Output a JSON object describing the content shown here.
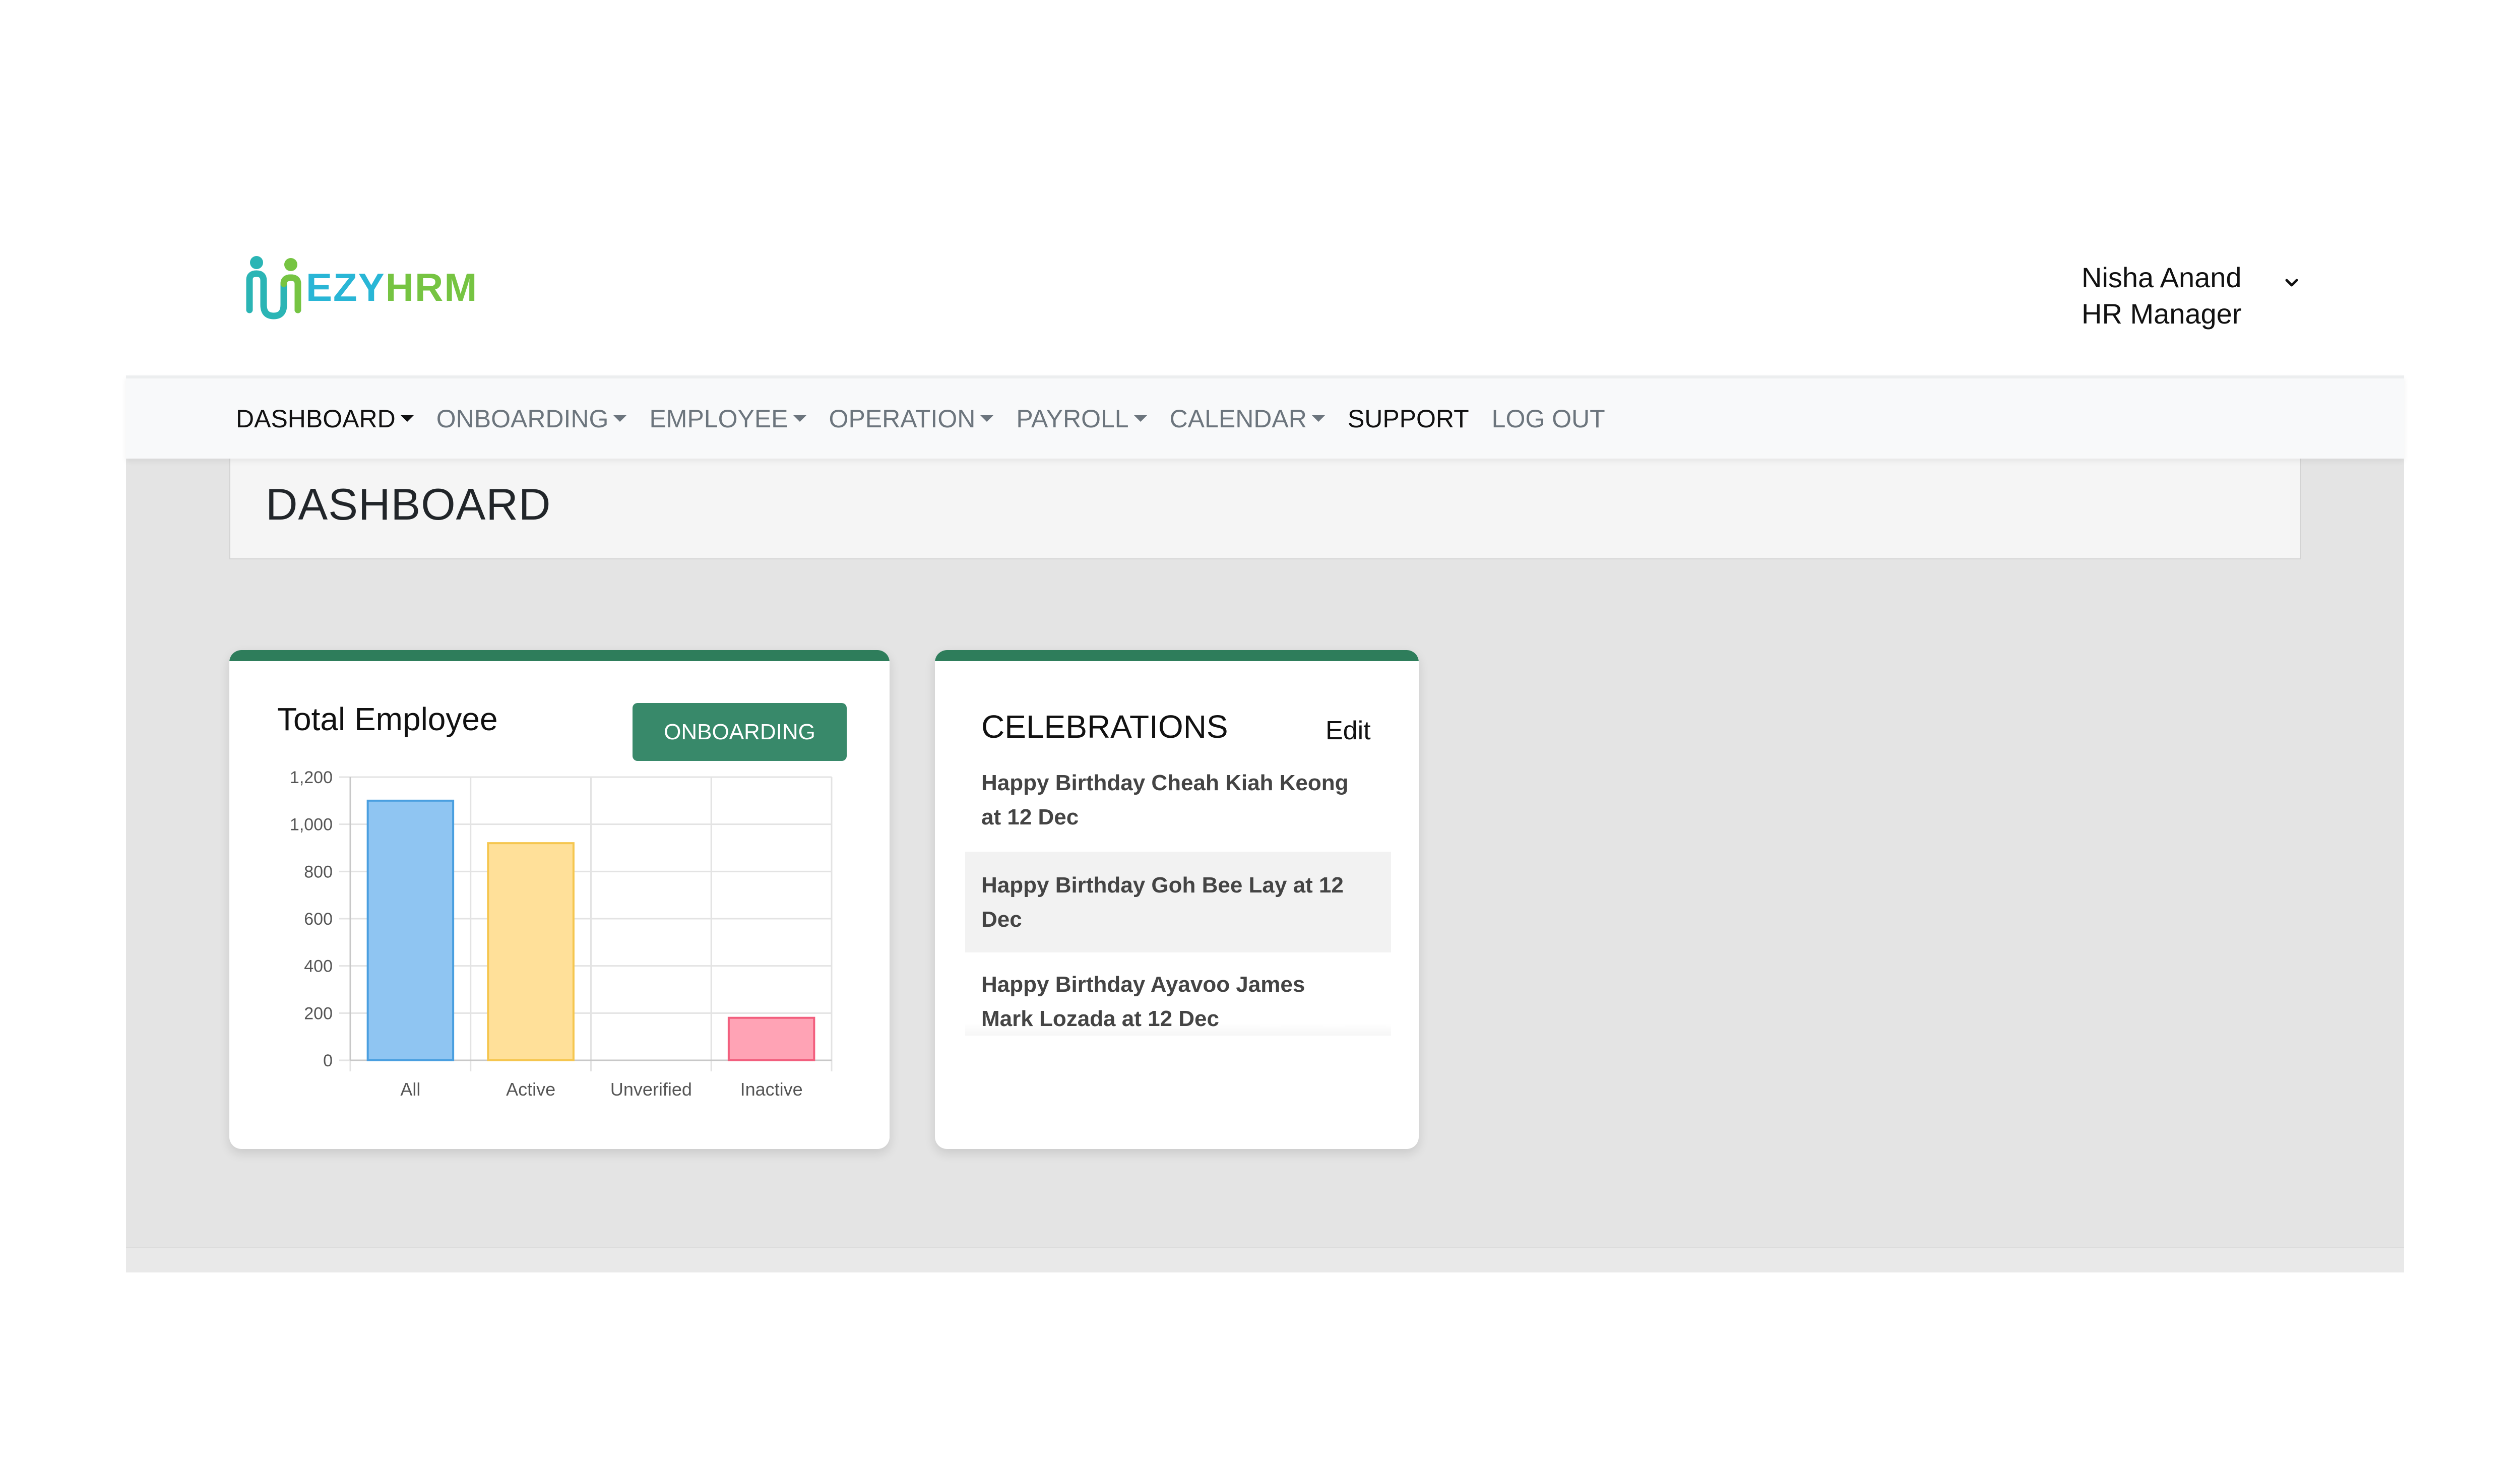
{
  "brand": {
    "ezy": "EZY",
    "hrm": "HRM",
    "colors": {
      "ezy": "#29b6d6",
      "hrm": "#76c442"
    }
  },
  "user": {
    "name": "Nisha Anand",
    "role": "HR Manager",
    "icon": "chevron-down-icon"
  },
  "nav": {
    "dashboard": "DASHBOARD",
    "onboarding": "ONBOARDING",
    "employee": "EMPLOYEE",
    "operation": "OPERATION",
    "payroll": "PAYROLL",
    "calendar": "CALENDAR",
    "support": "SUPPORT",
    "logout": "LOG OUT"
  },
  "page": {
    "title": "DASHBOARD"
  },
  "total_employee": {
    "title": "Total Employee",
    "button": "ONBOARDING",
    "accent": "#2e7d5b"
  },
  "chart_data": {
    "type": "bar",
    "categories": [
      "All",
      "Active",
      "Unverified",
      "Inactive"
    ],
    "values": [
      1100,
      920,
      0,
      180
    ],
    "ylim": [
      0,
      1200
    ],
    "yticks": [
      "0",
      "200",
      "400",
      "600",
      "800",
      "1,000",
      "1,200"
    ],
    "ytick_values": [
      0,
      200,
      400,
      600,
      800,
      1000,
      1200
    ],
    "grid": true,
    "fill_colors": [
      "#8fc5f2",
      "#ffe099",
      "#a8d8d8",
      "#ffa3b5"
    ],
    "stroke_colors": [
      "#4a9fe0",
      "#f5c64f",
      "#5fbcbc",
      "#f25f7e"
    ]
  },
  "celebrations": {
    "title": "CELEBRATIONS",
    "edit": "Edit",
    "items": [
      {
        "line1": "Happy Birthday Cheah Kiah Keong",
        "line2": "at 12 Dec"
      },
      {
        "line1": "Happy Birthday Goh Bee Lay at 12",
        "line2": "Dec"
      },
      {
        "line1": "Happy Birthday Ayavoo James",
        "line2": "Mark Lozada at 12 Dec"
      }
    ]
  }
}
